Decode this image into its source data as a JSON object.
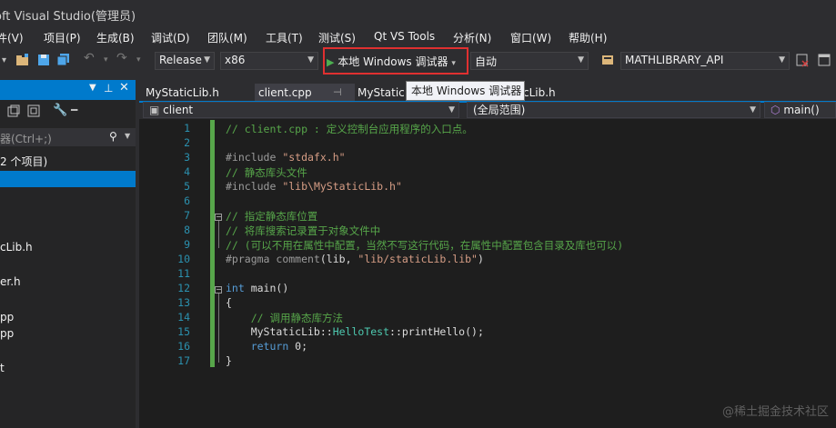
{
  "title": "oft Visual Studio(管理员)",
  "menu": [
    "件(V)",
    "项目(P)",
    "生成(B)",
    "调试(D)",
    "团队(M)",
    "工具(T)",
    "测试(S)",
    "Qt VS Tools",
    "分析(N)",
    "窗口(W)",
    "帮助(H)"
  ],
  "toolbar": {
    "config": "Release",
    "platform": "x86",
    "debugger": "本地 Windows 调试器",
    "mode": "自动",
    "macro": "MATHLIBRARY_API"
  },
  "tooltip": "本地 Windows 调试器",
  "left_panel": {
    "search_placeholder": "器(Ctrl+;)",
    "solution_line": "2 个项目)",
    "files": [
      "cLib.h",
      "er.h",
      "pp",
      "pp",
      "t"
    ]
  },
  "tabs": [
    "MyStaticLib.h",
    "client.cpp",
    "MyStatic",
    "cLib.h"
  ],
  "nav": {
    "project": "client",
    "scope": "(全局范围)",
    "member": "main()"
  },
  "watermark": "@稀土掘金技术社区",
  "colors": {
    "accent": "#007acc",
    "highlight_box": "#e03030",
    "change_bar": "#57a64a"
  }
}
